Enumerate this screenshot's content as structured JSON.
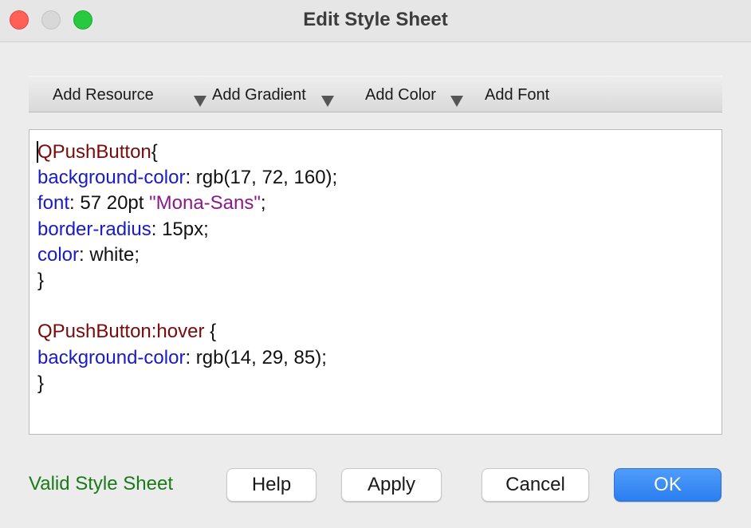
{
  "window": {
    "title": "Edit Style Sheet"
  },
  "toolbar": {
    "items": [
      {
        "label": "Add Resource",
        "has_dropdown": true
      },
      {
        "label": "Add Gradient",
        "has_dropdown": true
      },
      {
        "label": "Add Color",
        "has_dropdown": true
      },
      {
        "label": "Add Font",
        "has_dropdown": false
      }
    ]
  },
  "editor": {
    "lines": [
      [
        {
          "t": "QPushButton",
          "k": "sel"
        },
        {
          "t": "{",
          "k": "plain"
        }
      ],
      [
        {
          "t": "background-color",
          "k": "prop"
        },
        {
          "t": ": rgb(17, 72, 160);",
          "k": "plain"
        }
      ],
      [
        {
          "t": "font",
          "k": "prop"
        },
        {
          "t": ": 57 20pt ",
          "k": "plain"
        },
        {
          "t": "\"Mona-Sans\"",
          "k": "str"
        },
        {
          "t": ";",
          "k": "plain"
        }
      ],
      [
        {
          "t": "border-radius",
          "k": "prop"
        },
        {
          "t": ": 15px;",
          "k": "plain"
        }
      ],
      [
        {
          "t": "color",
          "k": "prop"
        },
        {
          "t": ": white;",
          "k": "plain"
        }
      ],
      [
        {
          "t": "}",
          "k": "plain"
        }
      ],
      [],
      [
        {
          "t": "QPushButton:hover",
          "k": "sel"
        },
        {
          "t": " {",
          "k": "plain"
        }
      ],
      [
        {
          "t": "background-color",
          "k": "prop"
        },
        {
          "t": ": rgb(14, 29, 85);",
          "k": "plain"
        }
      ],
      [
        {
          "t": "}",
          "k": "plain"
        }
      ]
    ]
  },
  "status": {
    "text": "Valid Style Sheet",
    "color": "#1a7a1a"
  },
  "buttons": {
    "help": "Help",
    "apply": "Apply",
    "cancel": "Cancel",
    "ok": "OK"
  },
  "colors": {
    "selector": "#7a0a0a",
    "property": "#1a1ac8",
    "string": "#8a1a8a",
    "accent": "#2b7ef0"
  }
}
